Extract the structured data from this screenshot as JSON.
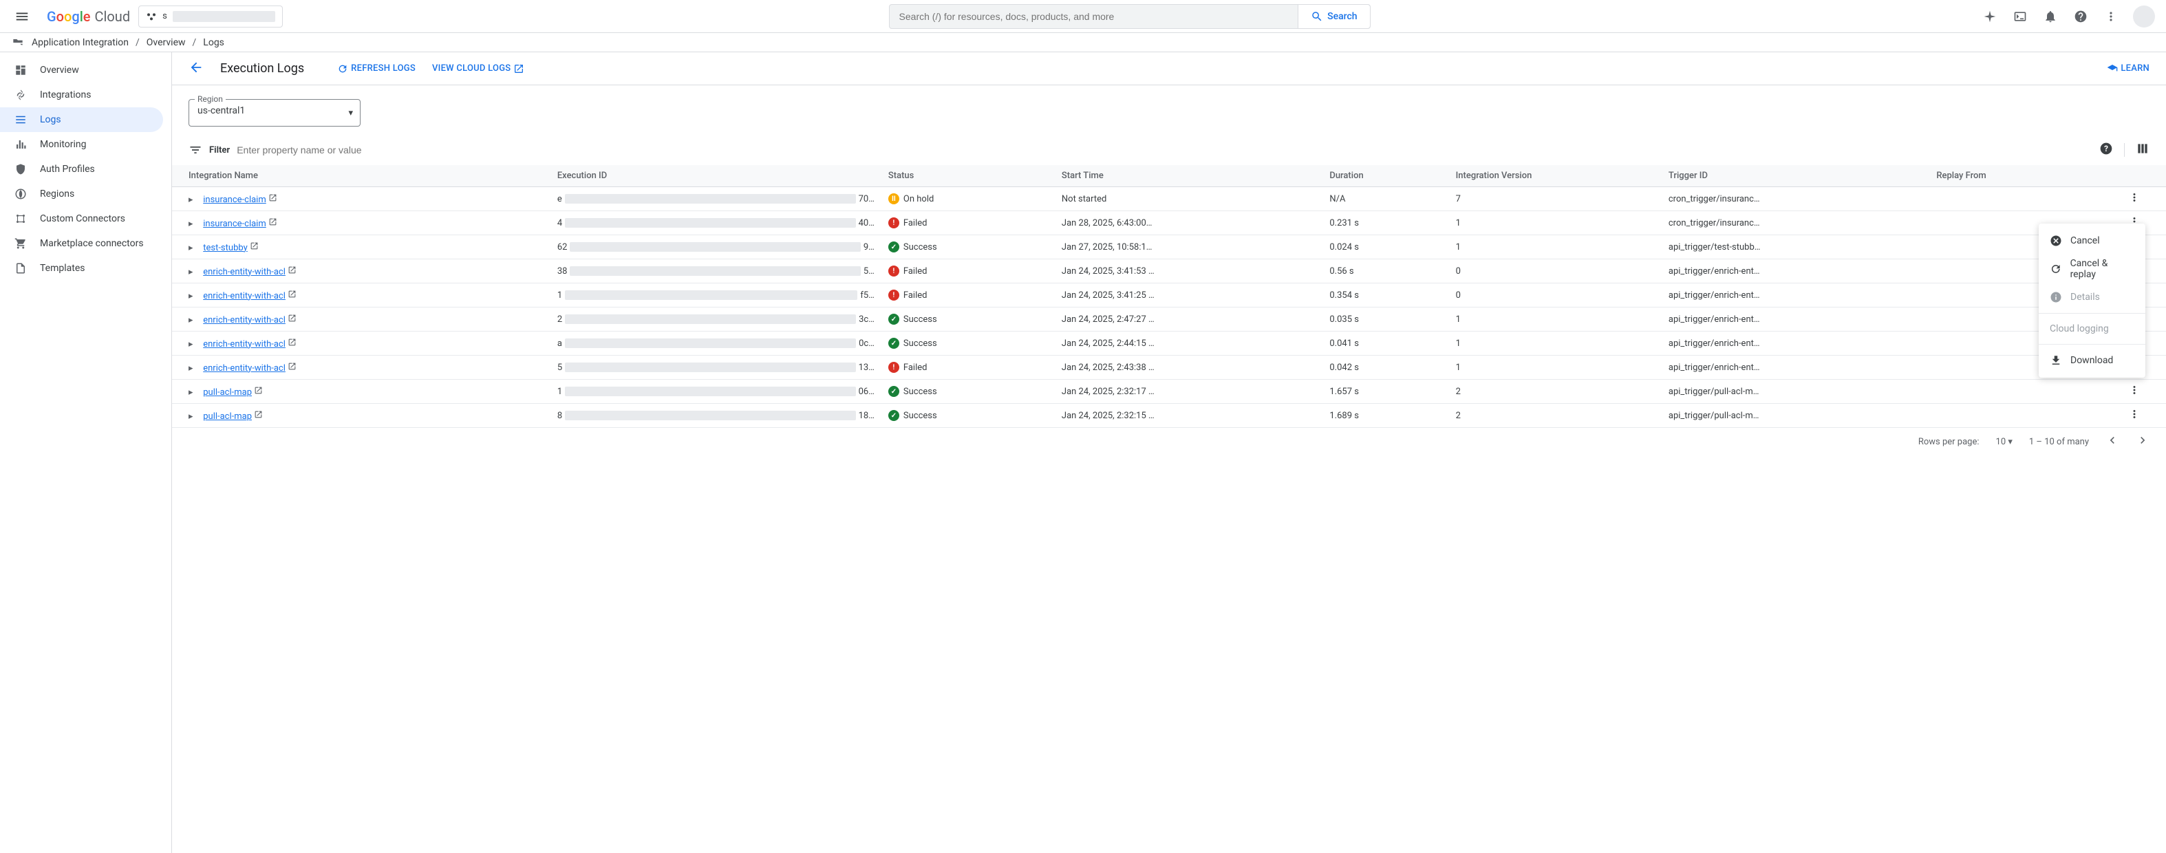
{
  "header": {
    "logo_cloud": "Cloud",
    "project_prefix": "s",
    "search_placeholder": "Search (/) for resources, docs, products, and more",
    "search_button": "Search"
  },
  "breadcrumb": {
    "product": "Application Integration",
    "section": "Overview",
    "page": "Logs"
  },
  "sidebar": {
    "items": [
      {
        "label": "Overview"
      },
      {
        "label": "Integrations"
      },
      {
        "label": "Logs"
      },
      {
        "label": "Monitoring"
      },
      {
        "label": "Auth Profiles"
      },
      {
        "label": "Regions"
      },
      {
        "label": "Custom Connectors"
      },
      {
        "label": "Marketplace connectors"
      },
      {
        "label": "Templates"
      }
    ]
  },
  "page": {
    "title": "Execution Logs",
    "refresh": "REFRESH LOGS",
    "cloud_logs": "VIEW CLOUD LOGS",
    "learn": "LEARN"
  },
  "region": {
    "label": "Region",
    "value": "us-central1"
  },
  "filter": {
    "label": "Filter",
    "placeholder": "Enter property name or value"
  },
  "table": {
    "headers": {
      "integration": "Integration Name",
      "execution": "Execution ID",
      "status": "Status",
      "start": "Start Time",
      "duration": "Duration",
      "version": "Integration Version",
      "trigger": "Trigger ID",
      "replay": "Replay From"
    },
    "rows": [
      {
        "integration": "insurance-claim",
        "exec_pre": "e",
        "exec_suf": "70…",
        "status": "On hold",
        "status_type": "hold",
        "start": "Not started",
        "duration": "N/A",
        "version": "7",
        "trigger": "cron_trigger/insuranc…"
      },
      {
        "integration": "insurance-claim",
        "exec_pre": "4",
        "exec_suf": "40…",
        "status": "Failed",
        "status_type": "fail",
        "start": "Jan 28, 2025, 6:43:00…",
        "duration": "0.231 s",
        "version": "1",
        "trigger": "cron_trigger/insuranc…"
      },
      {
        "integration": "test-stubby",
        "exec_pre": "62",
        "exec_suf": "9…",
        "status": "Success",
        "status_type": "succ",
        "start": "Jan 27, 2025, 10:58:1…",
        "duration": "0.024 s",
        "version": "1",
        "trigger": "api_trigger/test-stubb…"
      },
      {
        "integration": "enrich-entity-with-acl",
        "exec_pre": "38",
        "exec_suf": "5…",
        "status": "Failed",
        "status_type": "fail",
        "start": "Jan 24, 2025, 3:41:53 …",
        "duration": "0.56 s",
        "version": "0",
        "trigger": "api_trigger/enrich-ent…"
      },
      {
        "integration": "enrich-entity-with-acl",
        "exec_pre": "1",
        "exec_suf": "f5…",
        "status": "Failed",
        "status_type": "fail",
        "start": "Jan 24, 2025, 3:41:25 …",
        "duration": "0.354 s",
        "version": "0",
        "trigger": "api_trigger/enrich-ent…"
      },
      {
        "integration": "enrich-entity-with-acl",
        "exec_pre": "2",
        "exec_suf": "3c…",
        "status": "Success",
        "status_type": "succ",
        "start": "Jan 24, 2025, 2:47:27 …",
        "duration": "0.035 s",
        "version": "1",
        "trigger": "api_trigger/enrich-ent…"
      },
      {
        "integration": "enrich-entity-with-acl",
        "exec_pre": "a",
        "exec_suf": "0c…",
        "status": "Success",
        "status_type": "succ",
        "start": "Jan 24, 2025, 2:44:15 …",
        "duration": "0.041 s",
        "version": "1",
        "trigger": "api_trigger/enrich-ent…"
      },
      {
        "integration": "enrich-entity-with-acl",
        "exec_pre": "5",
        "exec_suf": "13…",
        "status": "Failed",
        "status_type": "fail",
        "start": "Jan 24, 2025, 2:43:38 …",
        "duration": "0.042 s",
        "version": "1",
        "trigger": "api_trigger/enrich-ent…"
      },
      {
        "integration": "pull-acl-map",
        "exec_pre": "1",
        "exec_suf": "06…",
        "status": "Success",
        "status_type": "succ",
        "start": "Jan 24, 2025, 2:32:17 …",
        "duration": "1.657 s",
        "version": "2",
        "trigger": "api_trigger/pull-acl-m…"
      },
      {
        "integration": "pull-acl-map",
        "exec_pre": "8",
        "exec_suf": "18…",
        "status": "Success",
        "status_type": "succ",
        "start": "Jan 24, 2025, 2:32:15 …",
        "duration": "1.689 s",
        "version": "2",
        "trigger": "api_trigger/pull-acl-m…"
      }
    ]
  },
  "pagination": {
    "rows_label": "Rows per page:",
    "rows_value": "10",
    "range": "1 – 10 of many"
  },
  "context_menu": {
    "cancel": "Cancel",
    "cancel_replay": "Cancel & replay",
    "details": "Details",
    "cloud_logging": "Cloud logging",
    "download": "Download"
  }
}
